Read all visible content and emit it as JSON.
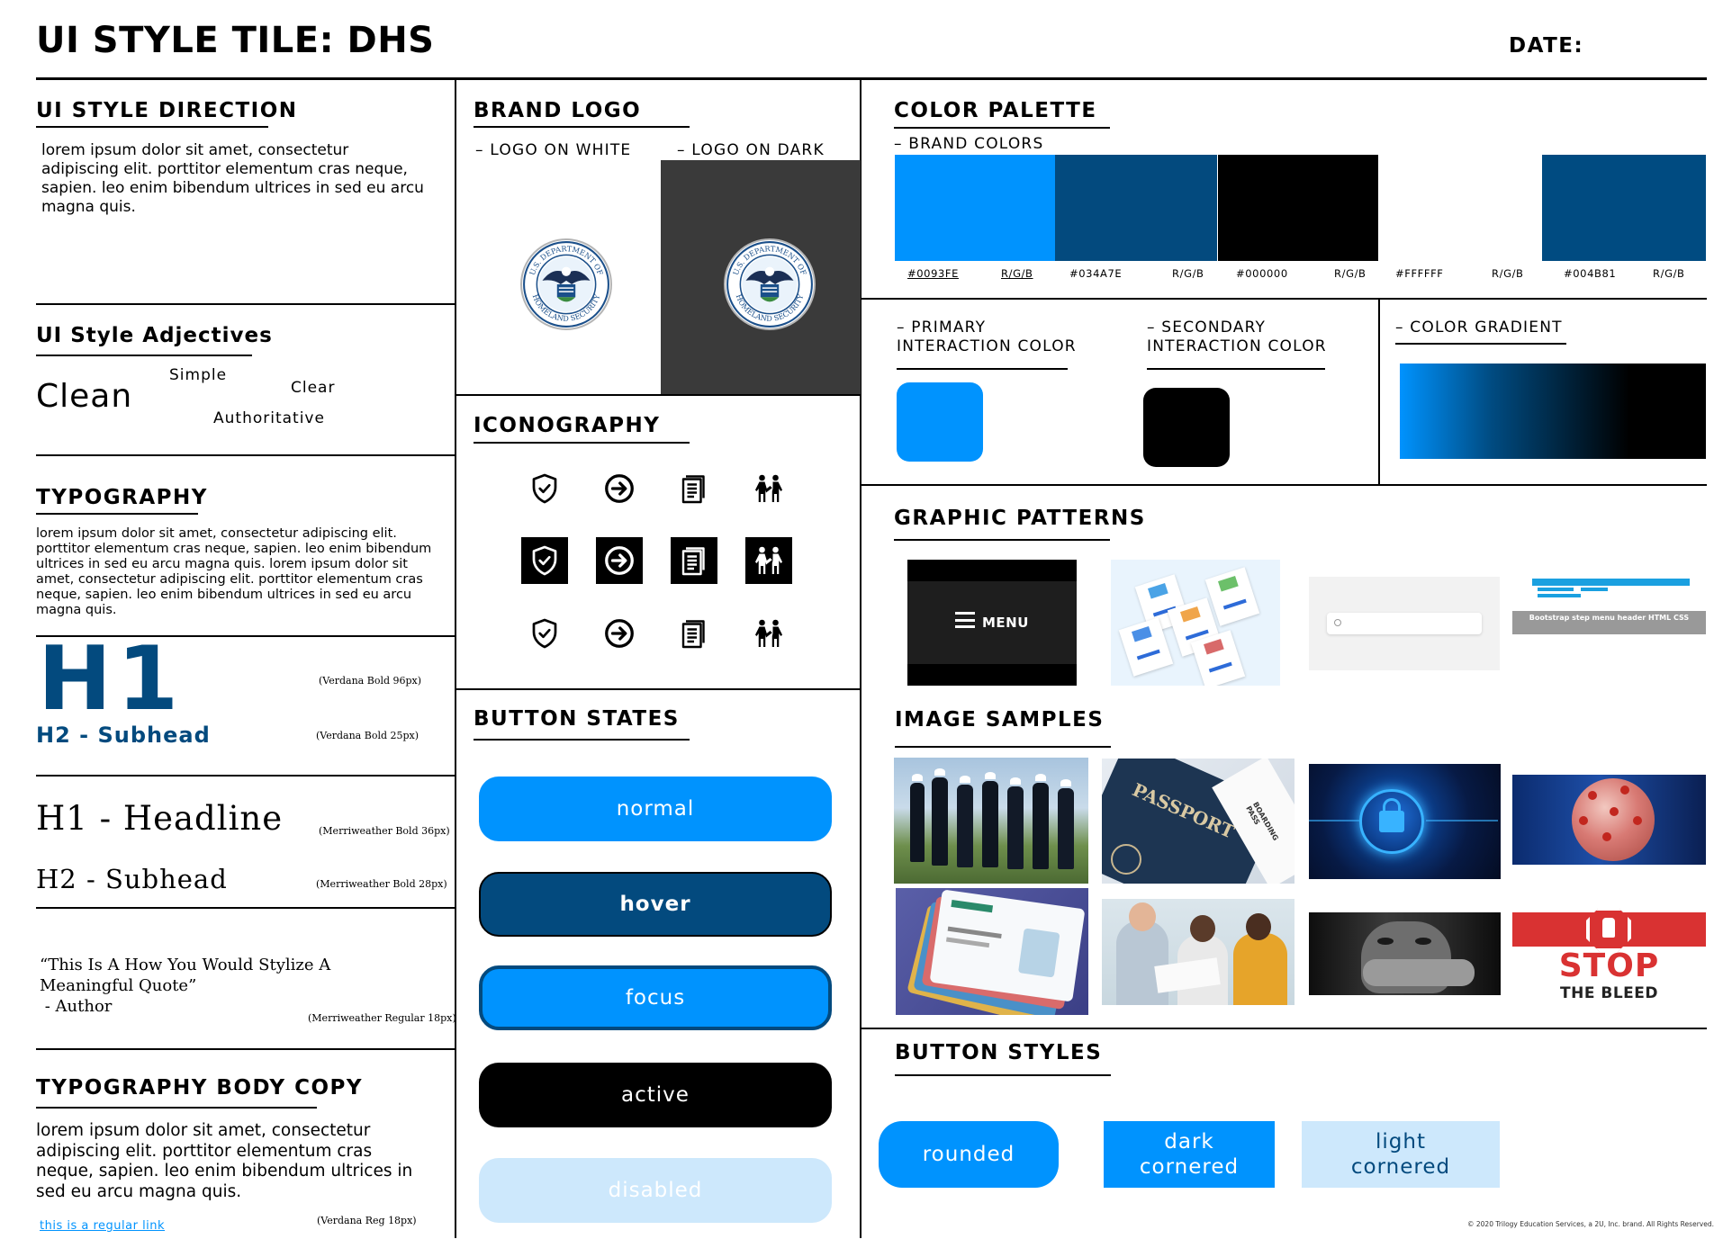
{
  "header": {
    "title": "UI STYLE TILE: DHS",
    "date_label": "DATE:"
  },
  "style_direction": {
    "heading": "UI STYLE DIRECTION",
    "body": "lorem ipsum dolor sit amet, consectetur adipiscing elit. porttitor elementum cras neque, sapien. leo enim bibendum ultrices in sed eu arcu magna quis."
  },
  "adjectives": {
    "heading": "UI Style Adjectives",
    "words": [
      "Clean",
      "Simple",
      "Clear",
      "Authoritative"
    ]
  },
  "typography": {
    "heading": "TYPOGRAPHY",
    "body": "lorem ipsum dolor sit amet, consectetur adipiscing elit. porttitor elementum cras neque, sapien. leo enim bibendum ultrices in sed eu arcu magna quis. lorem ipsum dolor sit amet, consectetur adipiscing elit. porttitor elementum cras neque, sapien. leo enim bibendum ultrices in sed eu arcu magna quis.",
    "h1_sample": "H1",
    "h1_spec": "(Verdana Bold 96px)",
    "h2_sample": "H2 - Subhead",
    "h2_spec": "(Verdana  Bold 25px)",
    "serif_h1": "H1 - Headline",
    "serif_h1_spec": "(Merriweather Bold 36px)",
    "serif_h2": "H2 - Subhead",
    "serif_h2_spec": "(Merriweather  Bold 28px)",
    "quote_line1": "“This Is A How You Would Stylize A",
    "quote_line2": "Meaningful Quote”",
    "quote_author": " - Author",
    "quote_spec": "(Merriweather Regular 18px)"
  },
  "body_copy": {
    "heading": "TYPOGRAPHY BODY COPY",
    "body": "lorem ipsum dolor sit amet, consectetur adipiscing elit. porttitor elementum cras neque, sapien. leo enim bibendum ultrices in sed eu arcu magna quis.",
    "spec": "(Verdana  Reg 18px)",
    "link": "this is a regular link"
  },
  "brand_logo": {
    "heading": "BRAND LOGO",
    "on_white": "– LOGO ON WHITE",
    "on_dark": "– LOGO ON DARK",
    "seal_top": "U.S. DEPARTMENT OF",
    "seal_bottom": "HOMELAND SECURITY"
  },
  "iconography": {
    "heading": "ICONOGRAPHY",
    "icons": [
      "shield-check-icon",
      "arrow-circle-right-icon",
      "documents-icon",
      "people-icon"
    ]
  },
  "button_states": {
    "heading": "BUTTON STATES",
    "normal": "normal",
    "hover": "hover",
    "focus": "focus",
    "active": "active",
    "disabled": "disabled"
  },
  "color_palette": {
    "heading": "COLOR PALETTE",
    "brand_label": "– BRAND COLORS",
    "swatches": [
      {
        "hex": "#0093FE",
        "rgb": "R/G/B"
      },
      {
        "hex": "#034A7E",
        "rgb": "R/G/B"
      },
      {
        "hex": "#000000",
        "rgb": "R/G/B"
      },
      {
        "hex": "#FFFFFF",
        "rgb": "R/G/B"
      },
      {
        "hex": "#004B81",
        "rgb": "R/G/B"
      }
    ],
    "primary_line1": "– PRIMARY",
    "primary_line2": "INTERACTION COLOR",
    "secondary_line1": "– SECONDARY",
    "secondary_line2": "INTERACTION COLOR",
    "gradient_label": "– COLOR GRADIENT"
  },
  "graphic_patterns": {
    "heading": "GRAPHIC PATTERNS",
    "menu_label": "MENU",
    "bootstrap_caption": "Bootstrap step menu header HTML CSS"
  },
  "image_samples": {
    "heading": "IMAGE SAMPLES",
    "passport_text": "PASSPORT",
    "boarding_text": "BOARDING PASS",
    "stop_text": "STOP",
    "bleed_text": "THE BLEED"
  },
  "button_styles": {
    "heading": "BUTTON STYLES",
    "rounded": "rounded",
    "dark_cornered_1": "dark",
    "dark_cornered_2": "cornered",
    "light_cornered_1": "light",
    "light_cornered_2": "cornered"
  },
  "footer": {
    "copyright": "© 2020 Trilogy Education Services, a 2U, Inc. brand. All Rights Reserved."
  },
  "colors": {
    "blue": "#0093FE",
    "dark_blue": "#034A7E",
    "navy": "#004B81",
    "light_blue": "#CDE8FC",
    "dark_gray": "#3A3A3A"
  }
}
